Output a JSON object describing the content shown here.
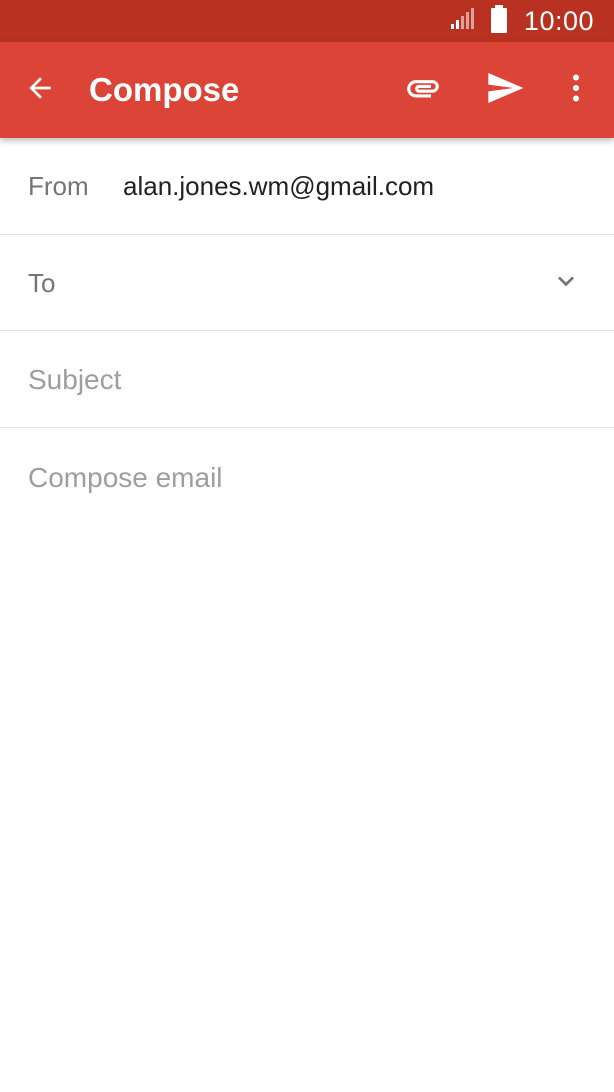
{
  "status_bar": {
    "time": "10:00",
    "icons": [
      "signal-icon",
      "battery-icon"
    ]
  },
  "app_bar": {
    "title": "Compose",
    "background_color": "#db4437",
    "icons": [
      "back-arrow-icon",
      "attach-icon",
      "send-icon",
      "more-vert-icon"
    ]
  },
  "form": {
    "from_label": "From",
    "from_value": "alan.jones.wm@gmail.com",
    "to_label": "To",
    "to_value": "",
    "to_expand_icon": "chevron-down-icon",
    "subject_placeholder": "Subject",
    "subject_value": "",
    "body_placeholder": "Compose email",
    "body_value": ""
  }
}
